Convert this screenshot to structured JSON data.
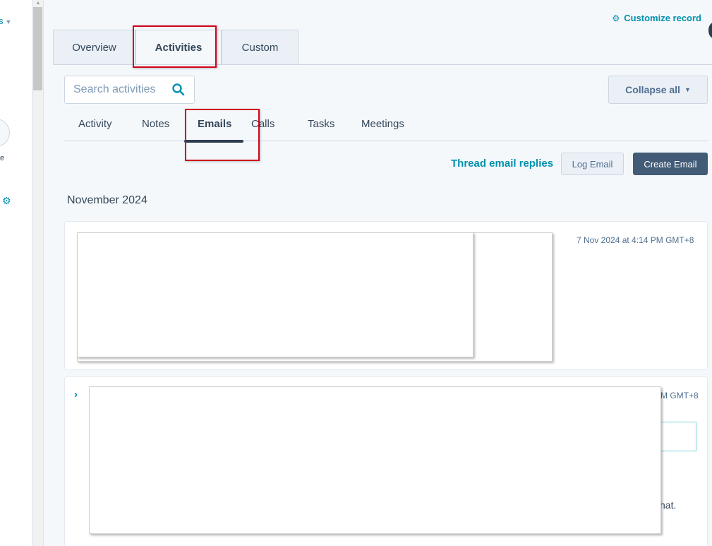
{
  "left_panel": {
    "caret_text": "s",
    "letter_fragment": "e"
  },
  "header": {
    "customize_label": "Customize record"
  },
  "record_tabs": [
    {
      "label": "Overview",
      "active": false
    },
    {
      "label": "Activities",
      "active": true
    },
    {
      "label": "Custom",
      "active": false
    }
  ],
  "search": {
    "placeholder": "Search activities",
    "value": ""
  },
  "collapse_label": "Collapse all",
  "activity_tabs": [
    {
      "label": "Activity",
      "active": false
    },
    {
      "label": "Notes",
      "active": false
    },
    {
      "label": "Emails",
      "active": true
    },
    {
      "label": "Calls",
      "active": false
    },
    {
      "label": "Tasks",
      "active": false
    },
    {
      "label": "Meetings",
      "active": false
    }
  ],
  "actions": {
    "thread_label": "Thread email replies",
    "log_label": "Log Email",
    "create_label": "Create Email"
  },
  "month_heading": "November 2024",
  "cards": [
    {
      "timestamp": "7 Nov 2024 at 4:14 PM GMT+8"
    },
    {
      "timestamp_fragment": "M GMT+8",
      "text_fragment": "hat."
    }
  ],
  "colors": {
    "accent": "#0091ae",
    "primary_button": "#425b76",
    "annotation": "#d0021b"
  }
}
